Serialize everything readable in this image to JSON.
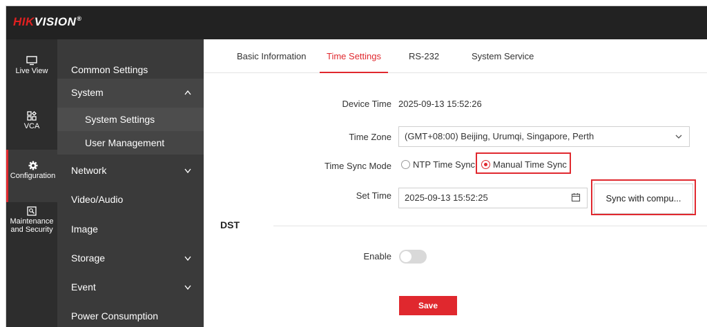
{
  "brand": {
    "logo_red": "HIK",
    "logo_white": "VISION",
    "logo_reg": "®"
  },
  "iconbar": [
    {
      "label": "Live View",
      "icon": "monitor-icon"
    },
    {
      "label": "VCA",
      "icon": "vca-icon"
    },
    {
      "label": "Configuration",
      "icon": "gear-icon",
      "active": true
    },
    {
      "label": "Maintenance and Security",
      "icon": "maintenance-icon"
    }
  ],
  "menu": {
    "common_settings": "Common Settings",
    "system": "System",
    "system_settings": "System Settings",
    "user_management": "User Management",
    "network": "Network",
    "video_audio": "Video/Audio",
    "image": "Image",
    "storage": "Storage",
    "event": "Event",
    "power_consumption": "Power Consumption"
  },
  "tabs": {
    "basic_information": "Basic Information",
    "time_settings": "Time Settings",
    "rs232": "RS-232",
    "system_service": "System Service"
  },
  "form": {
    "device_time_label": "Device Time",
    "device_time_value": "2025-09-13 15:52:26",
    "time_zone_label": "Time Zone",
    "time_zone_value": "(GMT+08:00) Beijing, Urumqi, Singapore, Perth",
    "time_sync_mode_label": "Time Sync Mode",
    "ntp_option": "NTP Time Sync",
    "manual_option": "Manual Time Sync",
    "selected_mode": "Manual Time Sync",
    "set_time_label": "Set Time",
    "set_time_value": "2025-09-13 15:52:25",
    "sync_button": "Sync with compu...",
    "dst_title": "DST",
    "enable_label": "Enable",
    "enable_value": false,
    "save_button": "Save"
  },
  "colors": {
    "accent": "#e0282e",
    "sidebar": "#3a3a3a",
    "iconbar": "#2d2d2d",
    "topbar": "#222222"
  }
}
